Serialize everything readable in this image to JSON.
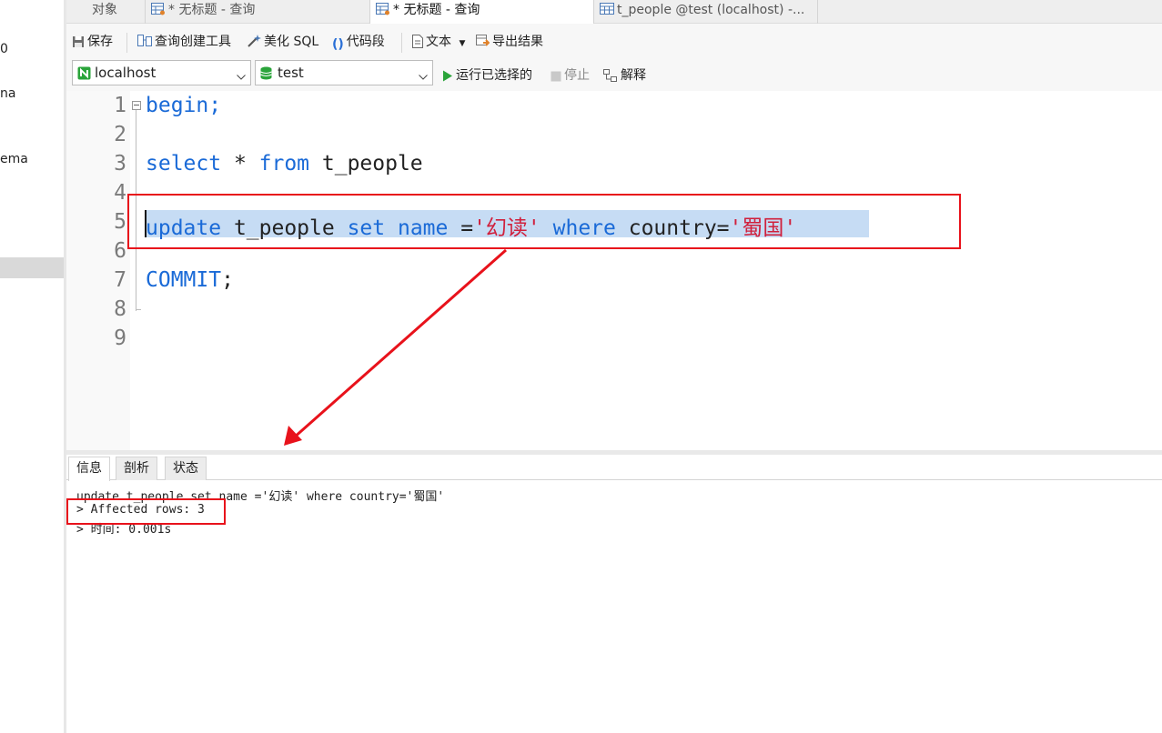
{
  "left_panel": {
    "items": [
      "0",
      "na",
      "ema"
    ]
  },
  "tabs": [
    {
      "label": "对象"
    },
    {
      "label": "* 无标题 - 查询"
    },
    {
      "label": "* 无标题 - 查询"
    },
    {
      "label": "t_people @test (localhost) -..."
    }
  ],
  "toolbar": {
    "save": "保存",
    "query_builder": "查询创建工具",
    "beautify": "美化 SQL",
    "snippet": "代码段",
    "text": "文本",
    "export": "导出结果"
  },
  "connection": {
    "server": "localhost",
    "database": "test",
    "run_selected": "运行已选择的",
    "stop": "停止",
    "explain": "解释"
  },
  "editor": {
    "line_numbers": [
      "1",
      "2",
      "3",
      "4",
      "5",
      "6",
      "7",
      "8",
      "9"
    ],
    "lines": {
      "l1": "begin;",
      "l3_kw1": "select",
      "l3_rest1": " * ",
      "l3_kw2": "from",
      "l3_rest2": " t_people",
      "l5_kw1": "update",
      "l5_t1": " t_people ",
      "l5_kw2": "set",
      "l5_t2": " ",
      "l5_kw3": "name",
      "l5_t3": " =",
      "l5_s1": "'幻读'",
      "l5_t4": " ",
      "l5_kw4": "where",
      "l5_t5": " country=",
      "l5_s2": "'蜀国'",
      "l7_kw": "COMMIT",
      "l7_rest": ";"
    }
  },
  "result_tabs": [
    {
      "label": "信息"
    },
    {
      "label": "剖析"
    },
    {
      "label": "状态"
    }
  ],
  "messages": {
    "query": "update t_people set name ='幻读' where country='蜀国'",
    "affected": "> Affected rows: 3",
    "time": "> 时间: 0.001s"
  },
  "colors": {
    "keyword": "#1a6ad7",
    "string": "#d0203c",
    "selection": "#c6dcf4",
    "annotation": "#e8121b"
  }
}
